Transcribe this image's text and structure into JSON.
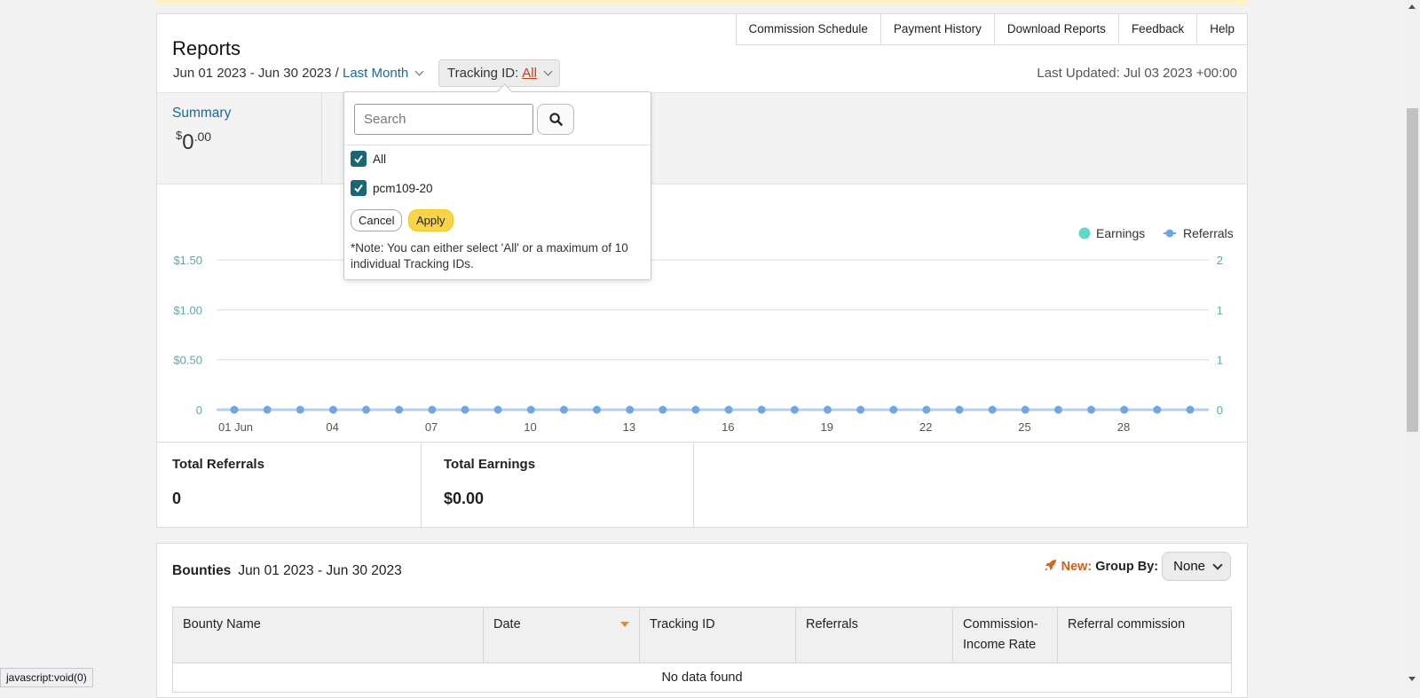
{
  "header": {
    "title": "Reports",
    "tabs": [
      "Commission Schedule",
      "Payment History",
      "Download Reports",
      "Feedback",
      "Help"
    ],
    "date_range": "Jun 01 2023 - Jun 30 2023",
    "date_separator": " / ",
    "period_link": "Last Month",
    "tracking_label": "Tracking ID:",
    "tracking_value": "All",
    "last_updated": "Last Updated: Jul 03 2023 +00:00"
  },
  "tiles": {
    "summary_label": "Summary",
    "summary_currency": "$",
    "summary_dollars": "0",
    "summary_cents": ".00"
  },
  "dropdown": {
    "search_placeholder": "Search",
    "items": [
      "All",
      "pcm109-20"
    ],
    "cancel_label": "Cancel",
    "apply_label": "Apply",
    "note": "*Note: You can either select 'All' or a maximum of 10 individual Tracking IDs."
  },
  "chart_data": {
    "type": "line",
    "legend": [
      "Earnings",
      "Referrals"
    ],
    "legend_position": "top-right",
    "colors": {
      "earnings": "#5fd8c4",
      "referrals": "#6fa6e4",
      "axis_text": "#5aa9a6"
    },
    "x": [
      1,
      2,
      3,
      4,
      5,
      6,
      7,
      8,
      9,
      10,
      11,
      12,
      13,
      14,
      15,
      16,
      17,
      18,
      19,
      20,
      21,
      22,
      23,
      24,
      25,
      26,
      27,
      28,
      29,
      30
    ],
    "x_ticks": [
      "01 Jun",
      "04",
      "07",
      "10",
      "13",
      "16",
      "19",
      "22",
      "25",
      "28"
    ],
    "x_tick_days": [
      1,
      4,
      7,
      10,
      13,
      16,
      19,
      22,
      25,
      28
    ],
    "y_left_ticks": [
      "$1.50",
      "$1.00",
      "$0.50",
      "0"
    ],
    "y_right_ticks": [
      "2",
      "1",
      "1",
      "0"
    ],
    "y_left_lim": [
      0,
      1.5
    ],
    "grid": true,
    "series": [
      {
        "name": "Earnings",
        "values": [
          0,
          0,
          0,
          0,
          0,
          0,
          0,
          0,
          0,
          0,
          0,
          0,
          0,
          0,
          0,
          0,
          0,
          0,
          0,
          0,
          0,
          0,
          0,
          0,
          0,
          0,
          0,
          0,
          0,
          0
        ]
      },
      {
        "name": "Referrals",
        "values": [
          0,
          0,
          0,
          0,
          0,
          0,
          0,
          0,
          0,
          0,
          0,
          0,
          0,
          0,
          0,
          0,
          0,
          0,
          0,
          0,
          0,
          0,
          0,
          0,
          0,
          0,
          0,
          0,
          0,
          0
        ]
      }
    ]
  },
  "stats": {
    "referrals_label": "Total Referrals",
    "referrals_value": "0",
    "earnings_label": "Total Earnings",
    "earnings_value": "$0.00"
  },
  "bounties": {
    "title": "Bounties",
    "date_range": "Jun 01 2023 - Jun 30 2023",
    "new_label": "New:",
    "group_by_label": "Group By:",
    "group_by_value": "None",
    "columns": [
      "Bounty Name",
      "Date",
      "Tracking ID",
      "Referrals",
      "Commission-Income Rate",
      "Referral commission"
    ],
    "empty_message": "No data found"
  },
  "statusbar": "javascript:void(0)"
}
